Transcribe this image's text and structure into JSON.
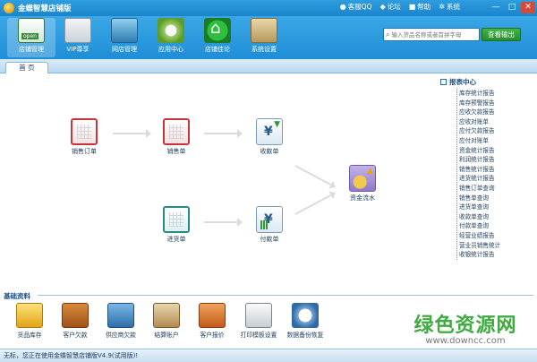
{
  "app": {
    "title": "金蝶智慧店铺版"
  },
  "title_links": [
    {
      "icon": "qq-icon",
      "label": "客服QQ"
    },
    {
      "icon": "forum-icon",
      "label": "论坛"
    },
    {
      "icon": "help-icon",
      "label": "帮助"
    },
    {
      "icon": "settings-icon",
      "label": "系统"
    }
  ],
  "toolbar": {
    "items": [
      {
        "label": "店铺管理",
        "icon": "shop-icon"
      },
      {
        "label": "VIP尊享",
        "icon": "vip-icon"
      },
      {
        "label": "网店管理",
        "icon": "web-store-icon"
      },
      {
        "label": "应用中心",
        "icon": "app-center-icon"
      },
      {
        "label": "店铺佳论",
        "icon": "store-home-icon"
      },
      {
        "label": "系统设置",
        "icon": "system-settings-icon"
      }
    ],
    "search_placeholder": "输入货品名称或者首拼字母",
    "search_button": "查看输出"
  },
  "tabs": {
    "home": "首 页"
  },
  "flow": {
    "sales_order": "销售订单",
    "sales_slip": "销售单",
    "receipt": "收款单",
    "cash_flow": "资金流水",
    "purchase": "进货单",
    "payment": "付款单"
  },
  "reports": {
    "title": "报表中心",
    "items": [
      "库存统计报告",
      "库存预警报告",
      "应收欠款报告",
      "应收对账单",
      "应付欠款报告",
      "应付对账单",
      "资金统计报告",
      "利润统计报告",
      "销售统计报告",
      "进货统计报告",
      "销售订单查询",
      "销售单查询",
      "进货单查询",
      "收款单查询",
      "付款单查询",
      "经营业绩报告",
      "营业员销售统计",
      "收银统计报告"
    ]
  },
  "basics": {
    "title": "基础资料",
    "items": [
      {
        "label": "货品库存",
        "icon": "goods-stock-icon"
      },
      {
        "label": "客户欠款",
        "icon": "customer-debt-icon"
      },
      {
        "label": "供应商欠款",
        "icon": "supplier-debt-icon"
      },
      {
        "label": "结算账户",
        "icon": "account-book-icon"
      },
      {
        "label": "客户报价",
        "icon": "price-tag-icon"
      },
      {
        "label": "打印模板设置",
        "icon": "printer-icon"
      },
      {
        "label": "数据备份恢复",
        "icon": "backup-icon"
      }
    ]
  },
  "status": {
    "text": "无标，您正在使用金蝶智慧店铺版V4.9(试用版)!"
  },
  "watermark": {
    "logo": "绿色资源网",
    "url": "www.downcc.com"
  }
}
